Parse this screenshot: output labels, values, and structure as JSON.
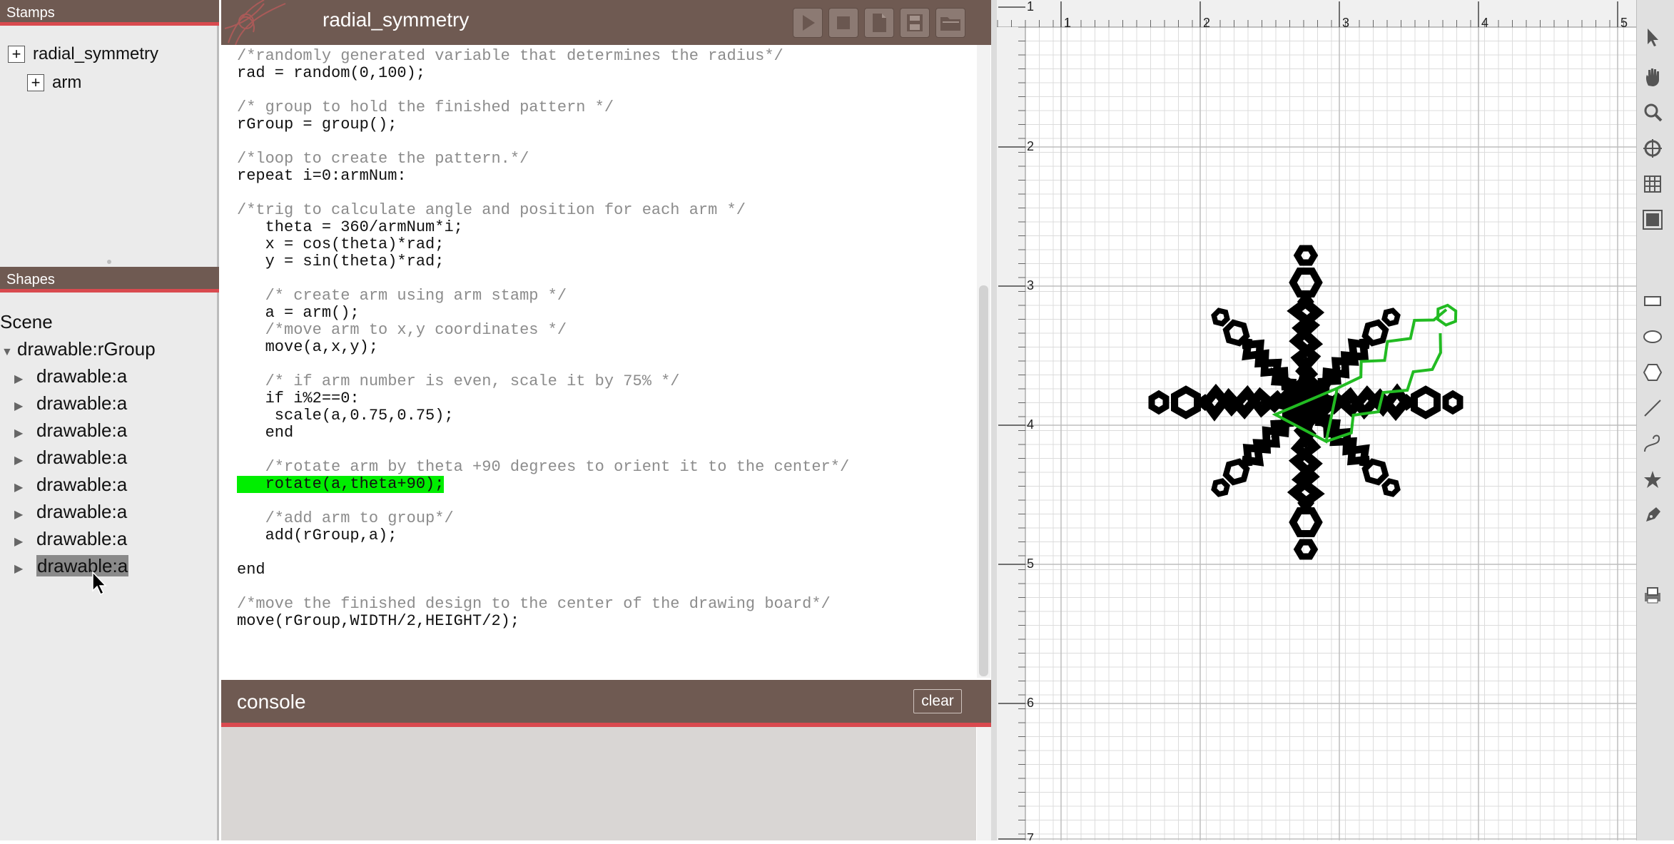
{
  "stamps_panel": {
    "title": "Stamps",
    "items": [
      {
        "label": "radial_symmetry"
      },
      {
        "label": "arm"
      }
    ]
  },
  "shapes_panel": {
    "title": "Shapes",
    "tree": {
      "root": "Scene",
      "group": "drawable:rGroup",
      "children": [
        "drawable:a",
        "drawable:a",
        "drawable:a",
        "drawable:a",
        "drawable:a",
        "drawable:a",
        "drawable:a",
        "drawable:a"
      ]
    }
  },
  "editor": {
    "title": "radial_symmetry",
    "toolbar": [
      {
        "icon": "play-icon"
      },
      {
        "icon": "stop-icon"
      },
      {
        "icon": "new-file-icon"
      },
      {
        "icon": "save-icon"
      },
      {
        "icon": "open-folder-icon"
      }
    ],
    "code": [
      "/*randomly generated variable that determines the radius*/",
      "rad = random(0,100);",
      "",
      "/* group to hold the finished pattern */",
      "rGroup = group();",
      "",
      "/*loop to create the pattern.*/",
      "repeat i=0:armNum:",
      "",
      "/*trig to calculate angle and position for each arm */",
      "   theta = 360/armNum*i;",
      "   x = cos(theta)*rad;",
      "   y = sin(theta)*rad;",
      "",
      "   /* create arm using arm stamp */",
      "   a = arm();",
      "   /*move arm to x,y coordinates */",
      "   move(a,x,y);",
      "",
      "   /* if arm number is even, scale it by 75% */",
      "   if i%2==0:",
      "    scale(a,0.75,0.75);",
      "   end",
      "",
      "   /*rotate arm by theta +90 degrees to orient it to the center*/",
      "   rotate(a,theta+90);",
      "",
      "   /*add arm to group*/",
      "   add(rGroup,a);",
      "",
      "end",
      "",
      "/*move the finished design to the center of the drawing board*/",
      "move(rGroup,WIDTH/2,HEIGHT/2);"
    ],
    "highlighted_line_index": 25
  },
  "console": {
    "title": "console",
    "clear_label": "clear"
  },
  "canvas": {
    "ruler_top_labels": [
      "1",
      "2",
      "3",
      "4",
      "5"
    ],
    "ruler_left_labels": [
      "1",
      "2",
      "3",
      "4",
      "5",
      "6",
      "7"
    ],
    "pattern_arms": 8,
    "colors": {
      "pattern": "#000000",
      "selected_arm": "#22bb22"
    }
  },
  "tools": [
    "select-arrow-icon",
    "hand-icon",
    "zoom-icon",
    "target-icon",
    "grid-icon",
    "frame-icon",
    "rectangle-icon",
    "ellipse-icon",
    "polygon-icon",
    "line-icon",
    "curve-icon",
    "star-icon",
    "pen-icon",
    "print-icon"
  ],
  "colors": {
    "header_bg": "#6f5a52",
    "accent_red": "#d94a4f",
    "highlight_green": "#00ee00"
  }
}
